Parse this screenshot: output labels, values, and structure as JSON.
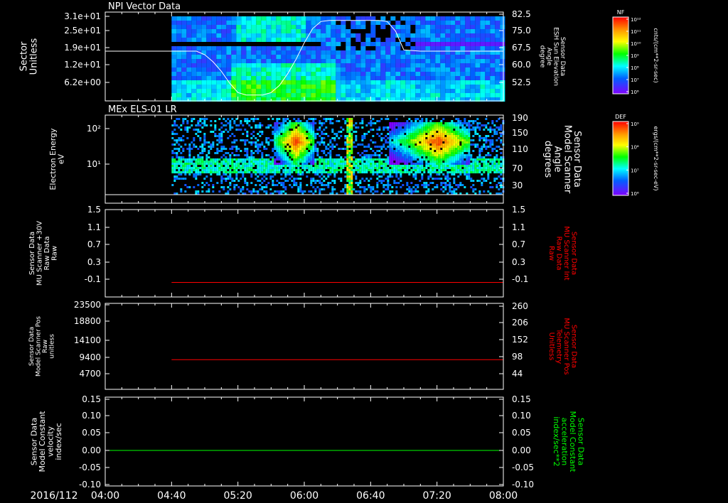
{
  "date_label": "2016/112",
  "time_ticks": [
    "04:00",
    "04:40",
    "05:20",
    "06:00",
    "06:40",
    "07:20",
    "08:00"
  ],
  "colors": {
    "background": "#000000",
    "axis": "#ffffff",
    "red_trace": "#ff0000",
    "green_trace": "#00ff00"
  },
  "chart_data": [
    {
      "type": "heatmap",
      "title": "NPI Vector Data",
      "left_label": [
        "Sector",
        "Unitless"
      ],
      "right_label": [
        "Sensor Data",
        "ESH Sun Elevation",
        "Angle",
        "degree"
      ],
      "left_ticks": [
        "3.1e+01",
        "2.5e+01",
        "1.9e+01",
        "1.2e+01",
        "6.2e+00"
      ],
      "right_ticks": [
        "82.5",
        "75.0",
        "67.5",
        "60.0",
        "52.5"
      ],
      "colorbar": {
        "label": "NF",
        "ticks": [
          "10¹²",
          "10¹¹",
          "10¹⁰",
          "10⁹",
          "10⁸",
          "10⁷",
          "10⁶"
        ],
        "units": "cnts/(cm**2-sr-sec)"
      },
      "overlay_line": {
        "name": "ESH Sun Elevation Angle",
        "x": [
          "04:00",
          "04:40",
          "04:55",
          "05:00",
          "05:05",
          "05:10",
          "05:15",
          "05:20",
          "05:25",
          "05:30",
          "05:35",
          "05:40",
          "05:45",
          "05:50",
          "05:55",
          "06:00",
          "06:05",
          "06:10",
          "06:15",
          "06:20",
          "06:30",
          "06:40",
          "06:45",
          "06:50",
          "06:55",
          "07:00",
          "07:10",
          "07:20",
          "07:40",
          "08:00"
        ],
        "y": [
          68.5,
          68.5,
          68.5,
          67,
          64,
          60,
          55,
          51,
          50,
          50,
          50,
          51,
          54,
          59,
          65,
          72,
          78,
          81,
          81.5,
          81.5,
          81.5,
          81.5,
          81.5,
          81,
          77,
          69,
          68.5,
          68.5,
          68.5,
          68.5
        ]
      }
    },
    {
      "type": "heatmap",
      "title": "MEx ELS-01 LR",
      "left_label": [
        "Electron Energy",
        "eV"
      ],
      "right_label": [
        "Sensor Data",
        "Model Scanner",
        "Angle",
        "degrees"
      ],
      "left_ticks": [
        "10²",
        "10¹"
      ],
      "right_ticks": [
        "190",
        "150",
        "110",
        "70",
        "30"
      ],
      "colorbar": {
        "label": "DEF",
        "ticks": [
          "10⁹",
          "10⁸",
          "10⁷",
          "10⁶"
        ],
        "units": "ergs/(cm**2-sr-sec-eV)"
      }
    },
    {
      "type": "line",
      "left_label": [
        "Sensor Data",
        "MU Scanner +30V",
        "Raw Data",
        "Raw"
      ],
      "right_label": [
        "Sensor Data",
        "MU Scanner Int",
        "Raw Data",
        "Raw"
      ],
      "left_ticks": [
        "1.5",
        "1.1",
        "0.7",
        "0.3",
        "-0.1"
      ],
      "right_ticks": [
        "1.5",
        "1.1",
        "0.7",
        "0.3",
        "-0.1"
      ],
      "ylim": [
        -0.3,
        1.5
      ],
      "series": [
        {
          "x": [
            "04:40",
            "08:00"
          ],
          "y": [
            0,
            0
          ],
          "color": "#ff0000"
        }
      ]
    },
    {
      "type": "line",
      "left_label": [
        "Sensor Data",
        "Model Scanner Pos",
        "Raw",
        "unitless"
      ],
      "right_label": [
        "Sensor Data",
        "MU Scanner Pos",
        "Telemetry",
        "Unitless"
      ],
      "left_ticks": [
        "23500",
        "18800",
        "14100",
        "9400",
        "4700"
      ],
      "right_ticks": [
        "260",
        "206",
        "152",
        "98",
        "44"
      ],
      "ylim": [
        0,
        23500
      ],
      "series": [
        {
          "x": [
            "04:40",
            "08:00"
          ],
          "y": [
            8100,
            8100
          ],
          "color": "#ff0000"
        }
      ]
    },
    {
      "type": "line",
      "left_label": [
        "Sensor Data",
        "Model Constant",
        "velocity",
        "index/sec"
      ],
      "right_label": [
        "Sensor Data",
        "Model Constant",
        "acceleration",
        "index/sec**2"
      ],
      "left_ticks": [
        "0.15",
        "0.10",
        "0.05",
        "0.00",
        "-0.05",
        "-0.10"
      ],
      "right_ticks": [
        "0.15",
        "0.10",
        "0.05",
        "0.00",
        "-0.05",
        "-0.10"
      ],
      "ylim": [
        -0.1,
        0.15
      ],
      "series": [
        {
          "x": [
            "04:00",
            "08:00"
          ],
          "y": [
            0,
            0
          ],
          "color": "#00ff00"
        }
      ]
    }
  ]
}
